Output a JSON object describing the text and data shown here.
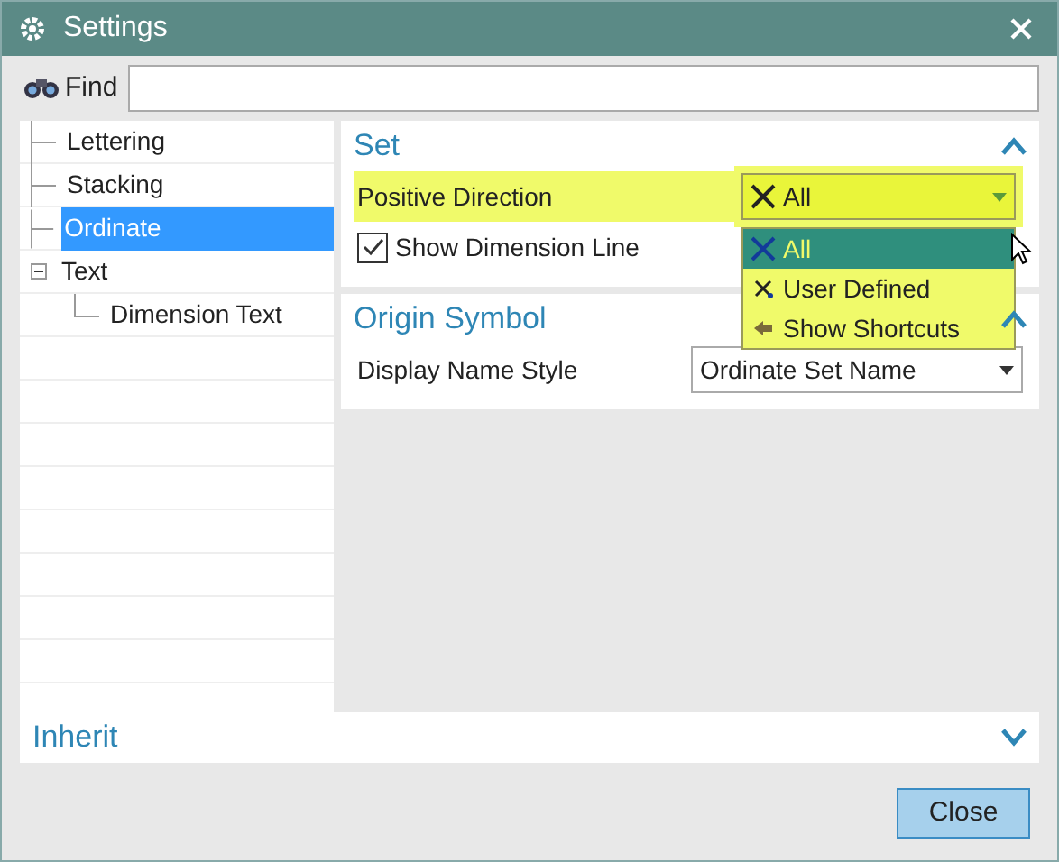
{
  "window": {
    "title": "Settings"
  },
  "find": {
    "label": "Find"
  },
  "tree": [
    {
      "label": "Lettering",
      "selected": false
    },
    {
      "label": "Stacking",
      "selected": false
    },
    {
      "label": "Ordinate",
      "selected": true
    },
    {
      "label": "Text",
      "selected": false,
      "expanded": true,
      "children": [
        {
          "label": "Dimension Text",
          "selected": false
        }
      ]
    }
  ],
  "sections": [
    {
      "title": "Set",
      "expanded": true,
      "rows": [
        {
          "kind": "dropdown",
          "label": "Positive Direction",
          "value": "All",
          "highlighted": true,
          "options": [
            {
              "label": "All",
              "selected": true
            },
            {
              "label": "User Defined",
              "selected": false
            },
            {
              "label": "Show Shortcuts",
              "selected": false
            }
          ]
        },
        {
          "kind": "checkbox",
          "label": "Show Dimension Line",
          "checked": true
        }
      ]
    },
    {
      "title": "Origin Symbol",
      "expanded": true,
      "rows": [
        {
          "kind": "dropdown",
          "label": "Display Name Style",
          "value": "Ordinate Set Name",
          "highlighted": false
        }
      ]
    }
  ],
  "inherit": {
    "title": "Inherit",
    "expanded": false
  },
  "buttons": [
    {
      "label": "Close"
    }
  ]
}
